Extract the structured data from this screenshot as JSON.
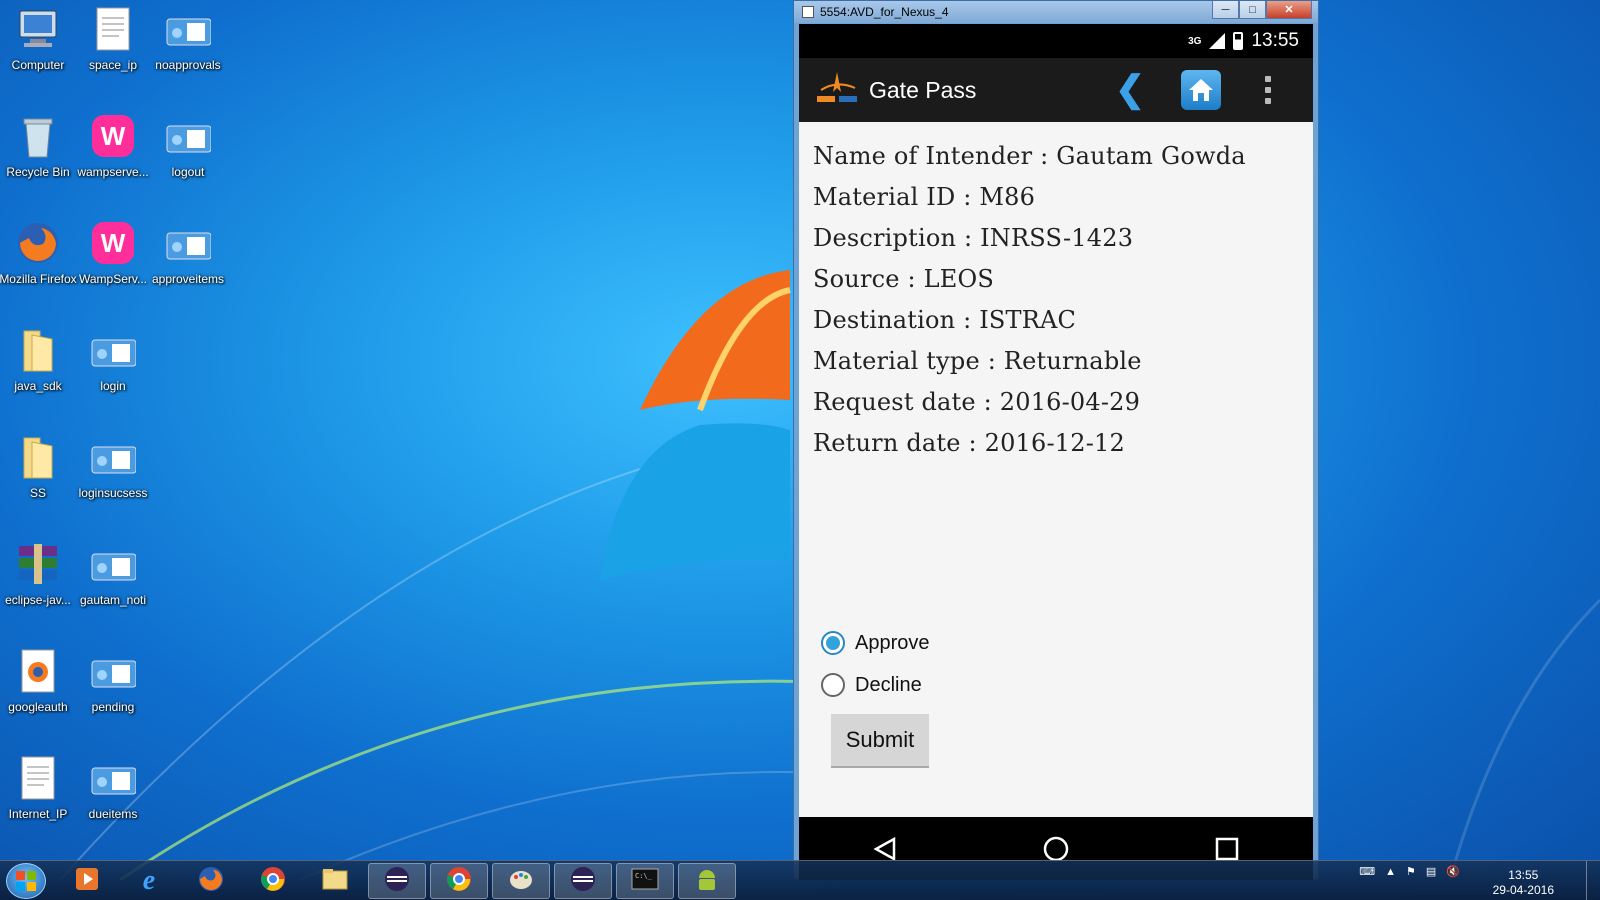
{
  "desktop": {
    "icons": [
      {
        "label": "Computer",
        "icon": "computer-icon"
      },
      {
        "label": "space_ip",
        "icon": "text-file-icon"
      },
      {
        "label": "noapprovals",
        "icon": "browser-shortcut-icon"
      },
      {
        "label": "Recycle Bin",
        "icon": "recycle-bin-icon"
      },
      {
        "label": "wampserve...",
        "icon": "wampserver-icon"
      },
      {
        "label": "logout",
        "icon": "browser-shortcut-icon"
      },
      {
        "label": "Mozilla Firefox",
        "icon": "firefox-icon"
      },
      {
        "label": "WampServ...",
        "icon": "wampserver-icon"
      },
      {
        "label": "approveitems",
        "icon": "browser-shortcut-icon"
      },
      {
        "label": "java_sdk",
        "icon": "folder-icon"
      },
      {
        "label": "login",
        "icon": "browser-shortcut-icon"
      },
      {
        "label": "SS",
        "icon": "folder-icon"
      },
      {
        "label": "loginsucsess",
        "icon": "browser-shortcut-icon"
      },
      {
        "label": "eclipse-jav...",
        "icon": "winrar-archive-icon"
      },
      {
        "label": "gautam_noti",
        "icon": "browser-shortcut-icon"
      },
      {
        "label": "googleauth",
        "icon": "firefox-html-file-icon"
      },
      {
        "label": "pending",
        "icon": "browser-shortcut-icon"
      },
      {
        "label": "Internet_IP",
        "icon": "text-file-icon"
      },
      {
        "label": "dueitems",
        "icon": "browser-shortcut-icon"
      }
    ]
  },
  "emulator": {
    "window_title": "5554:AVD_for_Nexus_4",
    "status": {
      "network": "3G",
      "time": "13:55"
    },
    "actionbar": {
      "title": "Gate Pass"
    },
    "details": [
      "Name of Intender : Gautam Gowda",
      "Material ID : M86",
      "Description : INRSS-1423",
      "Source : LEOS",
      "Destination : ISTRAC",
      "Material type : Returnable",
      "Request date : 2016-04-29",
      "Return date : 2016-12-12"
    ],
    "options": [
      {
        "label": "Approve",
        "checked": true
      },
      {
        "label": "Decline",
        "checked": false
      }
    ],
    "submit_label": "Submit"
  },
  "taskbar": {
    "apps": [
      "media-player-icon",
      "internet-explorer-icon",
      "firefox-icon",
      "chrome-icon",
      "file-explorer-icon",
      "eclipse-icon",
      "chrome-icon",
      "paint-icon",
      "eclipse-icon",
      "command-prompt-icon",
      "android-emulator-icon"
    ],
    "clock_time": "13:55",
    "clock_date": "29-04-2016"
  },
  "colors": {
    "accent": "#33a3dc",
    "actionbar": "#1b1b1b",
    "content_bg": "#f5f5f5"
  }
}
